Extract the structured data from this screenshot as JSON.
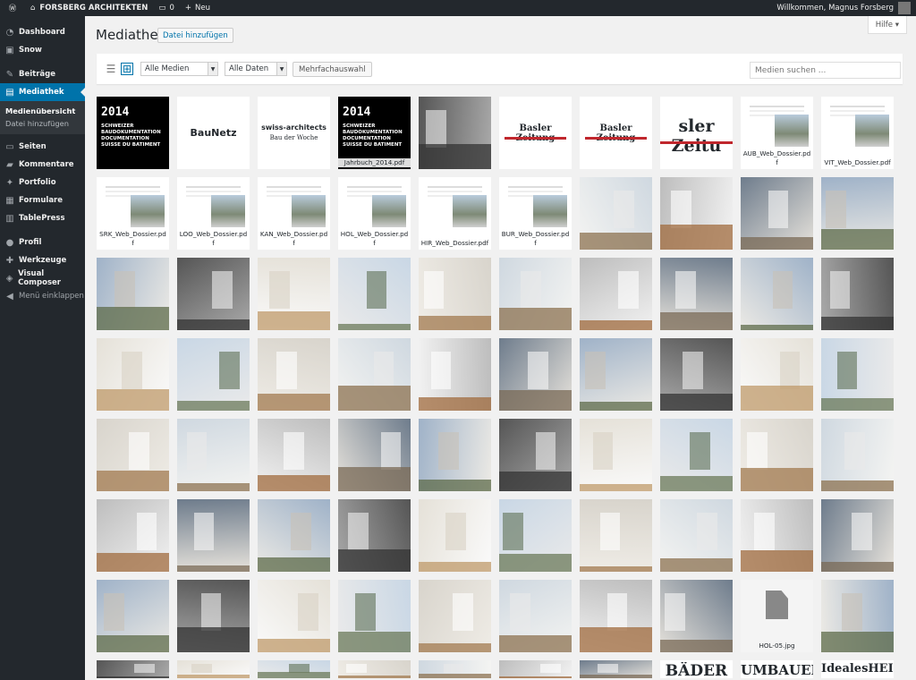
{
  "adminbar": {
    "site_name": "FORSBERG ARCHITEKTEN",
    "comments_count": "0",
    "new_label": "Neu",
    "greeting": "Willkommen, Magnus Forsberg"
  },
  "sidebar": {
    "items": [
      {
        "label": "Dashboard",
        "icon": "dashboard-icon",
        "glyph": "◔"
      },
      {
        "label": "Snow",
        "icon": "snow-logo-icon",
        "glyph": "▣"
      },
      {
        "label": "Beiträge",
        "icon": "pin-icon",
        "glyph": "✎"
      },
      {
        "label": "Mediathek",
        "icon": "media-icon",
        "glyph": "▤"
      },
      {
        "label": "Seiten",
        "icon": "pages-icon",
        "glyph": "▭"
      },
      {
        "label": "Kommentare",
        "icon": "comments-icon",
        "glyph": "▰"
      },
      {
        "label": "Portfolio",
        "icon": "portfolio-icon",
        "glyph": "✦"
      },
      {
        "label": "Formulare",
        "icon": "forms-icon",
        "glyph": "▦"
      },
      {
        "label": "TablePress",
        "icon": "table-icon",
        "glyph": "▥"
      },
      {
        "label": "Profil",
        "icon": "user-icon",
        "glyph": "●"
      },
      {
        "label": "Werkzeuge",
        "icon": "tools-icon",
        "glyph": "✚"
      },
      {
        "label": "Visual Composer",
        "icon": "visual-composer-icon",
        "glyph": "◈"
      }
    ],
    "submenu": [
      "Medienübersicht",
      "Datei hinzufügen"
    ],
    "collapse_label": "Menü einklappen"
  },
  "header": {
    "title": "Mediathek",
    "add_button": "Datei hinzufügen",
    "help_tab": "Hilfe ▾"
  },
  "toolbar": {
    "filter_media": "Alle Medien",
    "filter_dates": "Alle Daten",
    "multi_select": "Mehrfachauswahl",
    "search_placeholder": "Medien suchen ..."
  },
  "media": {
    "special": {
      "yearbook_year": "2014",
      "yearbook_lines": [
        "SCHWEIZER",
        "BAUDOKUMENTATION",
        "DOCUMENTATION",
        "SUISSE DU BATIMENT"
      ],
      "baunetz": "BauNetz",
      "swiss_architects": "swiss-architects",
      "bau_der_woche": "Bau der Woche",
      "basler_zeitung": "Basler Zeitung",
      "basler_zeitung_crop": "sler Zeitu"
    },
    "captions": {
      "jahrbuch": "Jahrbuch_2014.pdf",
      "aub": "AUB_Web_Dossier.pdf",
      "vit": "VIT_Web_Dossier.pdf",
      "srk": "SRK_Web_Dossier.pdf",
      "loo": "LOO_Web_Dossier.pdf",
      "kan": "KAN_Web_Dossier.pdf",
      "hol": "HOL_Web_Dossier.pdf",
      "hir": "HIR_Web_Dossier.pdf",
      "bur": "BUR_Web_Dossier.pdf",
      "hol05": "HOL-05.jpg"
    },
    "bottom_row_labels": [
      "BÄDER",
      "UMBAUEN + RENOVIEREN",
      "IdealesHEIM"
    ]
  }
}
